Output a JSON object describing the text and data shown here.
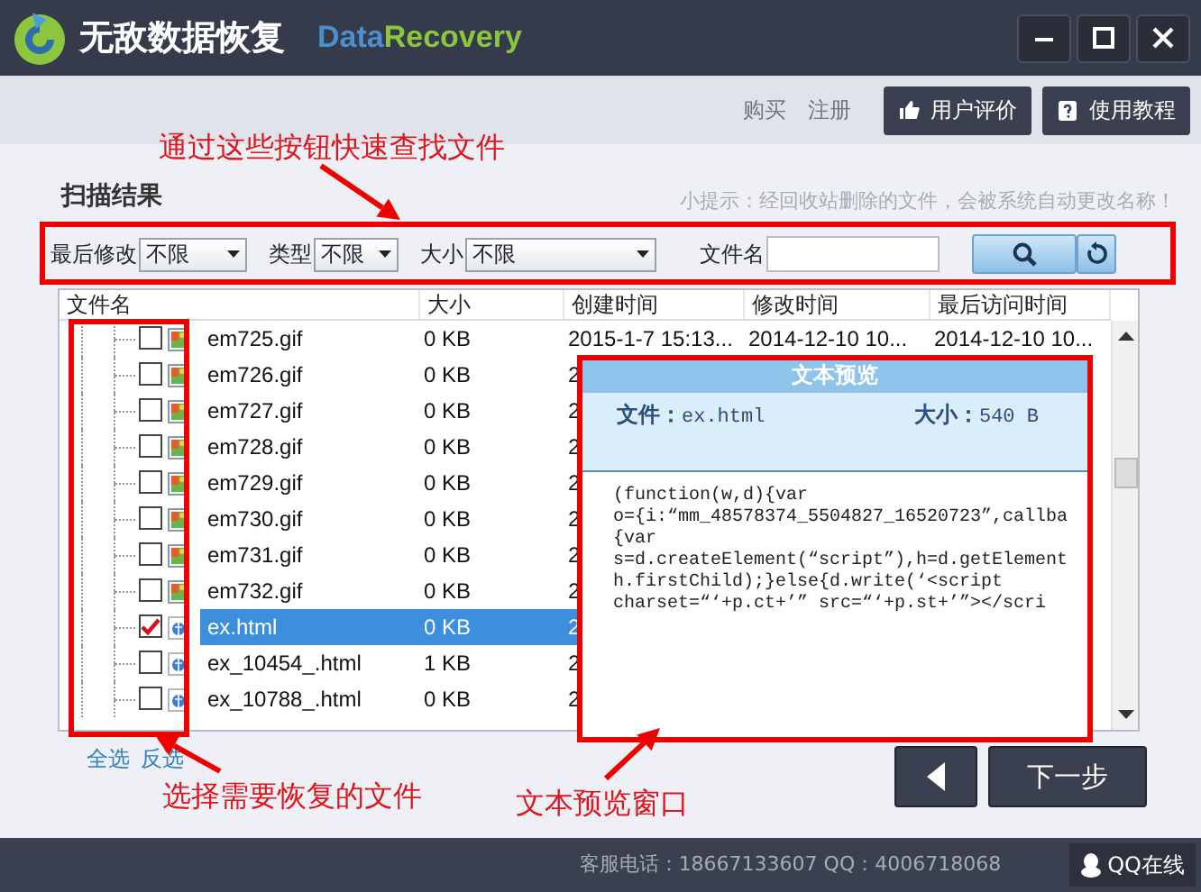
{
  "app": {
    "title": "无敌数据恢复",
    "brand": [
      {
        "text": "Data",
        "color": "#4a8fcf"
      },
      {
        "text": "Recovery",
        "color": "#8cc63f"
      }
    ]
  },
  "toolbar": {
    "links": [
      "购买",
      "注册"
    ],
    "buttons": [
      {
        "label": "用户评价",
        "kind": "thumb"
      },
      {
        "label": "使用教程",
        "kind": "guide"
      }
    ]
  },
  "scan": {
    "title": "扫描结果",
    "hint": "小提示：经回收站删除的文件，会被系统自动更改名称！"
  },
  "filters": [
    {
      "label": "最后修改",
      "value": "不限",
      "kind": "short"
    },
    {
      "label": "类型",
      "value": "不限",
      "kind": "short"
    },
    {
      "label": "大小",
      "value": "不限",
      "kind": "long"
    }
  ],
  "filename_filter": {
    "label": "文件名"
  },
  "table": {
    "columns": [
      "文件名",
      "大小",
      "创建时间",
      "修改时间",
      "最后访问时间"
    ],
    "rows": [
      {
        "name": "em725.gif",
        "size": "0 KB",
        "created": "2015-1-7 15:13...",
        "modified": "2014-12-10 10...",
        "accessed": "2014-12-10 10...",
        "kind": "gif",
        "checked": false,
        "selected": false
      },
      {
        "name": "em726.gif",
        "size": "0 KB",
        "created": "2",
        "kind": "gif",
        "checked": false,
        "selected": false
      },
      {
        "name": "em727.gif",
        "size": "0 KB",
        "created": "2",
        "kind": "gif",
        "checked": false,
        "selected": false
      },
      {
        "name": "em728.gif",
        "size": "0 KB",
        "created": "2",
        "kind": "gif",
        "checked": false,
        "selected": false
      },
      {
        "name": "em729.gif",
        "size": "0 KB",
        "created": "2",
        "kind": "gif",
        "checked": false,
        "selected": false
      },
      {
        "name": "em730.gif",
        "size": "0 KB",
        "created": "2",
        "kind": "gif",
        "checked": false,
        "selected": false
      },
      {
        "name": "em731.gif",
        "size": "0 KB",
        "created": "2",
        "kind": "gif",
        "checked": false,
        "selected": false
      },
      {
        "name": "em732.gif",
        "size": "0 KB",
        "created": "2",
        "kind": "gif",
        "checked": false,
        "selected": false
      },
      {
        "name": "ex.html",
        "size": "0 KB",
        "created": "2",
        "kind": "html",
        "checked": true,
        "selected": true
      },
      {
        "name": "ex_10454_.html",
        "size": "1 KB",
        "created": "2",
        "kind": "html",
        "checked": false,
        "selected": false
      },
      {
        "name": "ex_10788_.html",
        "size": "0 KB",
        "created": "2",
        "kind": "html",
        "checked": false,
        "selected": false
      }
    ]
  },
  "selection_links": [
    "全选",
    "反选"
  ],
  "preview": {
    "title": "文本预览",
    "file_label": "文件：",
    "file": "ex.html",
    "size_label": "大小：",
    "size": "540 B",
    "lines": [
      "(function(w,d){var",
      "o={i:“mm_48578374_5504827_16520723”,callba",
      "{var",
      "s=d.createElement(“script”),h=d.getElement",
      "h.firstChild);}else{d.write(‘<script",
      "charset=“‘+p.ct+’” src=“‘+p.st+’”></scri"
    ]
  },
  "next_button": "下一步",
  "status_bar": {
    "contact": "客服电话：18667133607 QQ：4006718068",
    "qq_button": "QQ在线"
  },
  "annotations": [
    {
      "text": "通过这些按钮快速查找文件",
      "kind": "filters"
    },
    {
      "text": "选择需要恢复的文件",
      "kind": "checkboxes"
    },
    {
      "text": "文本预览窗口",
      "kind": "preview"
    }
  ]
}
